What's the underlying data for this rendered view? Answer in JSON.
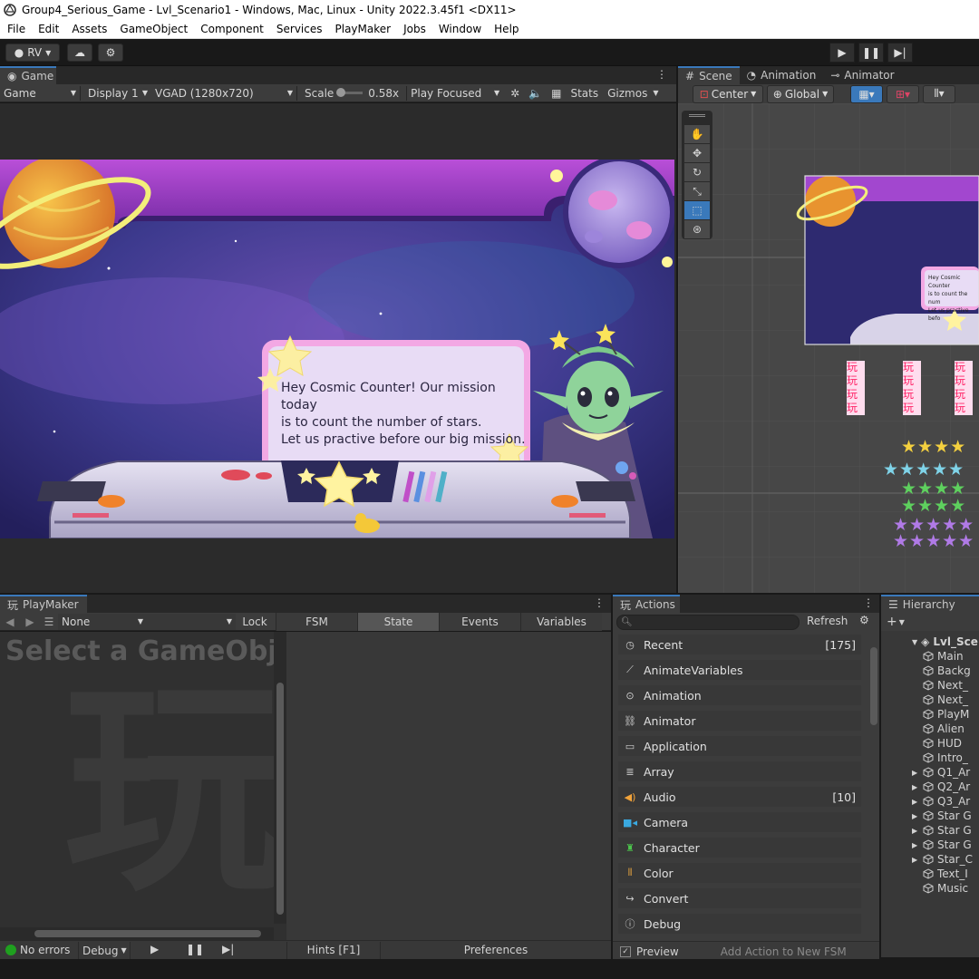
{
  "window": {
    "title": "Group4_Serious_Game - Lvl_Scenario1 - Windows, Mac, Linux - Unity 2022.3.45f1 <DX11>"
  },
  "menu": [
    "File",
    "Edit",
    "Assets",
    "GameObject",
    "Component",
    "Services",
    "PlayMaker",
    "Jobs",
    "Window",
    "Help"
  ],
  "toolbar": {
    "account": "RV"
  },
  "game_panel": {
    "tab": "Game",
    "mode": "Game",
    "display": "Display 1",
    "resolution": "VGAD (1280x720)",
    "scale_label": "Scale",
    "scale_value": "0.58x",
    "play_focus": "Play Focused",
    "stats": "Stats",
    "gizmos": "Gizmos"
  },
  "game_scene": {
    "dialog_line1": "Hey Cosmic Counter! Our mission today",
    "dialog_line2": "is to count the number of stars.",
    "dialog_line3": "Let us practive before our big mission."
  },
  "scene_panel": {
    "tabs": [
      "Scene",
      "Animation",
      "Animator"
    ],
    "pivot": "Center",
    "space": "Global",
    "mini_dialog_line1": "Hey Cosmic Counter",
    "mini_dialog_line2": "is to count the num",
    "mini_dialog_line3": "Let us practive befo"
  },
  "playmaker": {
    "tab": "PlayMaker",
    "selector": "None",
    "lock": "Lock",
    "tabs": [
      "FSM",
      "State",
      "Events",
      "Variables"
    ],
    "placeholder": "Select a GameObjec",
    "watermark": "玩"
  },
  "actions": {
    "tab": "Actions",
    "refresh": "Refresh",
    "items": [
      {
        "label": "Recent",
        "count": "[175]",
        "icon": "clock-icon",
        "color": "#cfcfcf"
      },
      {
        "label": "AnimateVariables",
        "count": "",
        "icon": "curve-icon",
        "color": "#cfcfcf"
      },
      {
        "label": "Animation",
        "count": "",
        "icon": "play-circle-icon",
        "color": "#cfcfcf"
      },
      {
        "label": "Animator",
        "count": "",
        "icon": "animator-icon",
        "color": "#cfcfcf"
      },
      {
        "label": "Application",
        "count": "",
        "icon": "monitor-icon",
        "color": "#cfcfcf"
      },
      {
        "label": "Array",
        "count": "",
        "icon": "list-icon",
        "color": "#cfcfcf"
      },
      {
        "label": "Audio",
        "count": "[10]",
        "icon": "speaker-icon",
        "color": "#f2a33a"
      },
      {
        "label": "Camera",
        "count": "",
        "icon": "camera-icon",
        "color": "#3aa9e0"
      },
      {
        "label": "Character",
        "count": "",
        "icon": "character-icon",
        "color": "#4cc44c"
      },
      {
        "label": "Color",
        "count": "",
        "icon": "color-bars-icon",
        "color": "#e0a040"
      },
      {
        "label": "Convert",
        "count": "",
        "icon": "convert-icon",
        "color": "#cfcfcf"
      },
      {
        "label": "Debug",
        "count": "",
        "icon": "info-icon",
        "color": "#cfcfcf"
      }
    ],
    "preview": "Preview",
    "add_action": "Add Action to New FSM"
  },
  "hierarchy": {
    "tab": "Hierarchy",
    "root": "Lvl_Sce",
    "items": [
      {
        "label": "Main",
        "arrow": false
      },
      {
        "label": "Backg",
        "arrow": false
      },
      {
        "label": "Next_",
        "arrow": false
      },
      {
        "label": "Next_",
        "arrow": false
      },
      {
        "label": "PlayM",
        "arrow": false
      },
      {
        "label": "Alien",
        "arrow": false
      },
      {
        "label": "HUD",
        "arrow": false
      },
      {
        "label": "Intro_",
        "arrow": false
      },
      {
        "label": "Q1_Ar",
        "arrow": true
      },
      {
        "label": "Q2_Ar",
        "arrow": true
      },
      {
        "label": "Q3_Ar",
        "arrow": true
      },
      {
        "label": "Star G",
        "arrow": true
      },
      {
        "label": "Star G",
        "arrow": true
      },
      {
        "label": "Star G",
        "arrow": true
      },
      {
        "label": "Star_C",
        "arrow": true
      },
      {
        "label": "Text_I",
        "arrow": false
      },
      {
        "label": "Music",
        "arrow": false
      }
    ]
  },
  "status": {
    "errors": "No errors",
    "debug": "Debug",
    "hints": "Hints [F1]",
    "preferences": "Preferences"
  }
}
